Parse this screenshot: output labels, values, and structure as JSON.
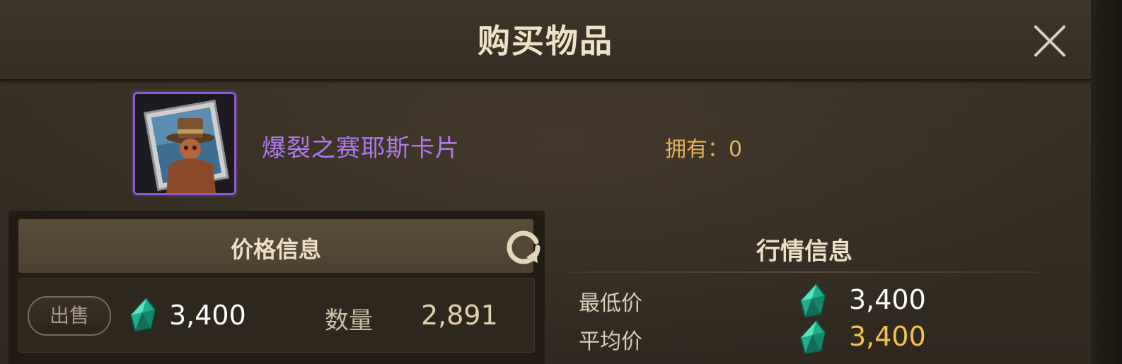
{
  "dialog": {
    "title": "购买物品",
    "close_icon": "close-icon"
  },
  "item": {
    "name": "爆裂之赛耶斯卡片",
    "owned_text": "拥有：0",
    "icon": "card-portrait-icon",
    "rarity_color": "#8b5ad4"
  },
  "price_info": {
    "header": "价格信息",
    "refresh_icon": "refresh-icon",
    "sell_label": "出售",
    "currency_icon": "gem-icon",
    "price": "3,400",
    "quantity_label": "数量",
    "quantity": "2,891"
  },
  "market_info": {
    "header": "行情信息",
    "rows": [
      {
        "label": "最低价",
        "value": "3,400",
        "value_color": "#ffffff"
      },
      {
        "label": "平均价",
        "value": "3,400",
        "value_color": "#f2c14e"
      }
    ]
  }
}
